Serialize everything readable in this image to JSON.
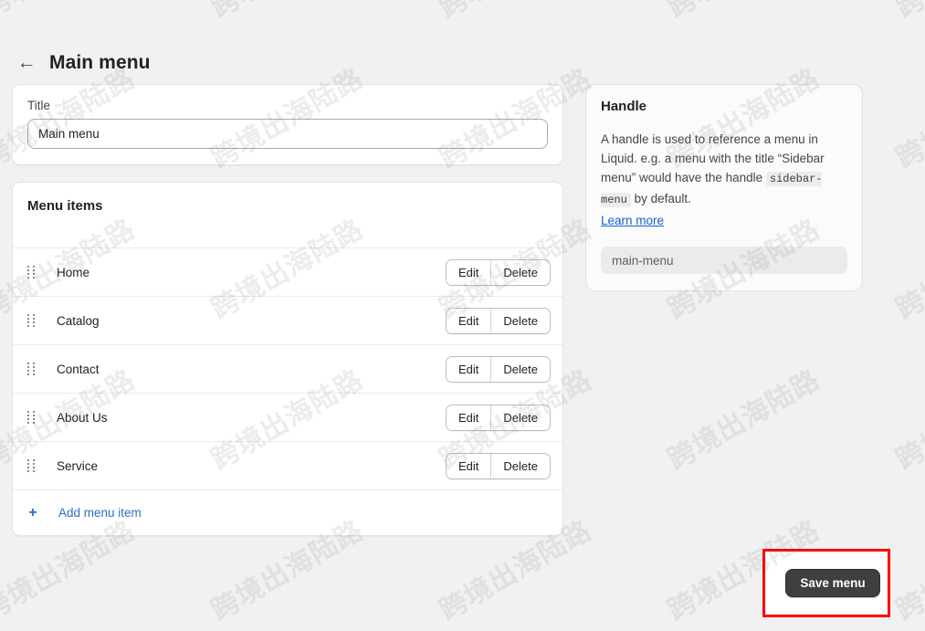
{
  "header": {
    "back_icon": "arrow-left-icon",
    "back_glyph": "←",
    "title": "Main menu"
  },
  "title_card": {
    "label": "Title",
    "value": "Main menu",
    "placeholder": "Title"
  },
  "menu_items_card": {
    "heading": "Menu items",
    "rows": [
      {
        "label": "Home",
        "handle_icon": "drag-handle-icon",
        "edit": "Edit",
        "delete": "Delete"
      },
      {
        "label": "Catalog",
        "handle_icon": "drag-handle-icon",
        "edit": "Edit",
        "delete": "Delete"
      },
      {
        "label": "Contact",
        "handle_icon": "drag-handle-icon",
        "edit": "Edit",
        "delete": "Delete"
      },
      {
        "label": "About Us",
        "handle_icon": "drag-handle-icon",
        "edit": "Edit",
        "delete": "Delete"
      },
      {
        "label": "Service",
        "handle_icon": "drag-handle-icon",
        "edit": "Edit",
        "delete": "Delete"
      }
    ],
    "add_item": {
      "plus_glyph": "+",
      "plus_icon": "plus-icon",
      "label": "Add menu item"
    }
  },
  "handle_card": {
    "heading": "Handle",
    "description_part1": "A handle is used to reference a menu in Liquid. e.g. a menu with the title “Sidebar menu” would have the handle ",
    "description_code": "sidebar-menu",
    "description_part2": " by default.",
    "learn_more": "Learn more",
    "value": "main-menu"
  },
  "footer": {
    "save_label": "Save menu"
  },
  "watermark": {
    "text": "跨境出海陆路"
  },
  "colors": {
    "page_background": "#f1f1f1",
    "card_background": "#ffffff",
    "link": "#2c6ecb",
    "learn_more_link": "#1a62d4",
    "save_button_background": "#3f3f3f",
    "annotation_border": "#fd0000",
    "text_primary": "#202223",
    "text_secondary": "#43464a"
  }
}
